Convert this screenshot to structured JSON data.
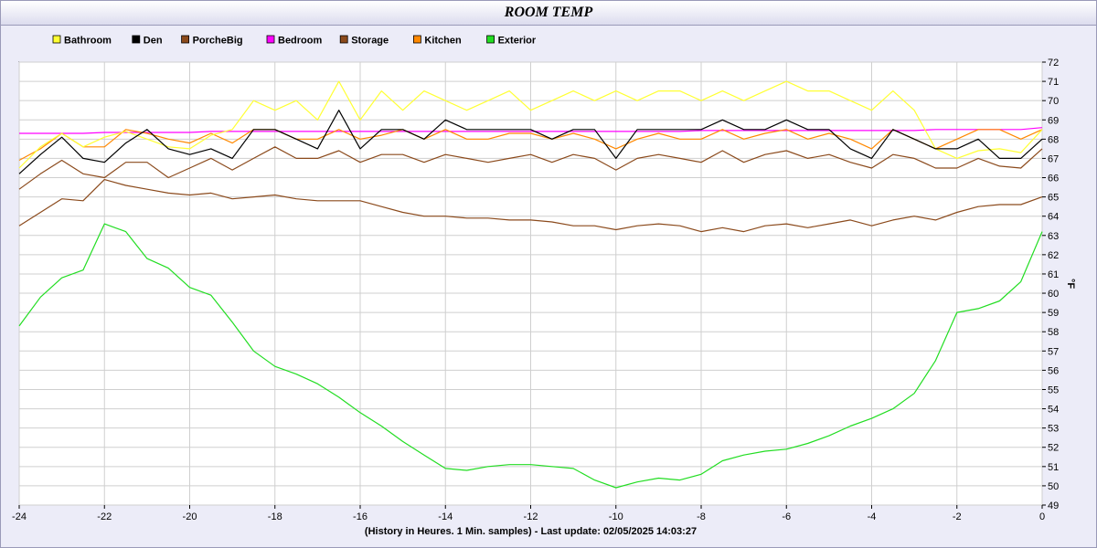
{
  "chart_data": {
    "type": "line",
    "title": "ROOM TEMP",
    "xlabel": "(History in Heures. 1 Min. samples) - Last update: 02/05/2025 14:03:27",
    "ylabel": "°F",
    "xlim": [
      -24,
      0
    ],
    "ylim": [
      49,
      72
    ],
    "x_ticks": [
      -24,
      -22,
      -20,
      -18,
      -16,
      -14,
      -12,
      -10,
      -8,
      -6,
      -4,
      -2,
      0
    ],
    "y_ticks": [
      49,
      50,
      51,
      52,
      53,
      54,
      55,
      56,
      57,
      58,
      59,
      60,
      61,
      62,
      63,
      64,
      65,
      66,
      67,
      68,
      69,
      70,
      71,
      72
    ],
    "grid": true,
    "legend_position": "top-left",
    "x": [
      -24,
      -23.5,
      -23,
      -22.5,
      -22,
      -21.5,
      -21,
      -20.5,
      -20,
      -19.5,
      -19,
      -18.5,
      -18,
      -17.5,
      -17,
      -16.5,
      -16,
      -15.5,
      -15,
      -14.5,
      -14,
      -13.5,
      -13,
      -12.5,
      -12,
      -11.5,
      -11,
      -10.5,
      -10,
      -9.5,
      -9,
      -8.5,
      -8,
      -7.5,
      -7,
      -6.5,
      -6,
      -5.5,
      -5,
      -4.5,
      -4,
      -3.5,
      -3,
      -2.5,
      -2,
      -1.5,
      -1,
      -0.5,
      0
    ],
    "series": [
      {
        "name": "Bathroom",
        "color": "#ffff33",
        "values": [
          66.5,
          67.6,
          68.3,
          67.6,
          68.1,
          68.4,
          68.0,
          67.6,
          67.5,
          68.2,
          68.5,
          70.0,
          69.5,
          70.0,
          69.0,
          71.0,
          69.0,
          70.5,
          69.5,
          70.5,
          70.0,
          69.5,
          70.0,
          70.5,
          69.5,
          70.0,
          70.5,
          70.0,
          70.5,
          70.0,
          70.5,
          70.5,
          70.0,
          70.5,
          70.0,
          70.5,
          71.0,
          70.5,
          70.5,
          70.0,
          69.5,
          70.5,
          69.5,
          67.5,
          67.0,
          67.4,
          67.5,
          67.3,
          68.5
        ]
      },
      {
        "name": "Den",
        "color": "#000000",
        "values": [
          66.2,
          67.2,
          68.1,
          67.0,
          66.8,
          67.8,
          68.5,
          67.5,
          67.2,
          67.5,
          67.0,
          68.5,
          68.5,
          68.0,
          67.5,
          69.5,
          67.5,
          68.5,
          68.5,
          68.0,
          69.0,
          68.5,
          68.5,
          68.5,
          68.5,
          68.0,
          68.5,
          68.5,
          67.0,
          68.5,
          68.5,
          68.5,
          68.5,
          69.0,
          68.5,
          68.5,
          69.0,
          68.5,
          68.5,
          67.5,
          67.0,
          68.5,
          68.0,
          67.5,
          67.5,
          68.0,
          67.0,
          67.0,
          68.0
        ]
      },
      {
        "name": "PorcheBig",
        "color": "#8b4a1c",
        "values": [
          63.5,
          64.2,
          64.9,
          64.8,
          65.9,
          65.6,
          65.4,
          65.2,
          65.1,
          65.2,
          64.9,
          65.0,
          65.1,
          64.9,
          64.8,
          64.8,
          64.8,
          64.5,
          64.2,
          64.0,
          64.0,
          63.9,
          63.9,
          63.8,
          63.8,
          63.7,
          63.5,
          63.5,
          63.3,
          63.5,
          63.6,
          63.5,
          63.2,
          63.4,
          63.2,
          63.5,
          63.6,
          63.4,
          63.6,
          63.8,
          63.5,
          63.8,
          64.0,
          63.8,
          64.2,
          64.5,
          64.6,
          64.6,
          65.0
        ]
      },
      {
        "name": "Bedroom",
        "color": "#ff00ff",
        "values": [
          68.3,
          68.3,
          68.3,
          68.3,
          68.35,
          68.35,
          68.35,
          68.35,
          68.35,
          68.4,
          68.4,
          68.4,
          68.4,
          68.4,
          68.4,
          68.4,
          68.4,
          68.4,
          68.4,
          68.4,
          68.4,
          68.4,
          68.4,
          68.4,
          68.4,
          68.4,
          68.4,
          68.4,
          68.4,
          68.4,
          68.4,
          68.4,
          68.45,
          68.45,
          68.45,
          68.45,
          68.45,
          68.45,
          68.45,
          68.45,
          68.45,
          68.45,
          68.45,
          68.5,
          68.5,
          68.5,
          68.5,
          68.5,
          68.6
        ]
      },
      {
        "name": "Storage",
        "color": "#8b4a1c",
        "values": [
          65.4,
          66.2,
          66.9,
          66.2,
          66.0,
          66.8,
          66.8,
          66.0,
          66.5,
          67.0,
          66.4,
          67.0,
          67.6,
          67.0,
          67.0,
          67.4,
          66.8,
          67.2,
          67.2,
          66.8,
          67.2,
          67.0,
          66.8,
          67.0,
          67.2,
          66.8,
          67.2,
          67.0,
          66.4,
          67.0,
          67.2,
          67.0,
          66.8,
          67.4,
          66.8,
          67.2,
          67.4,
          67.0,
          67.2,
          66.8,
          66.5,
          67.2,
          67.0,
          66.5,
          66.5,
          67.0,
          66.6,
          66.5,
          67.5
        ]
      },
      {
        "name": "Kitchen",
        "color": "#ff8800",
        "values": [
          66.9,
          67.5,
          68.3,
          67.6,
          67.6,
          68.5,
          68.3,
          68.0,
          67.8,
          68.3,
          67.8,
          68.5,
          68.5,
          68.0,
          68.0,
          68.5,
          68.0,
          68.2,
          68.5,
          68.0,
          68.5,
          68.0,
          68.0,
          68.3,
          68.3,
          68.0,
          68.3,
          68.0,
          67.5,
          68.0,
          68.3,
          68.0,
          68.0,
          68.5,
          68.0,
          68.3,
          68.5,
          68.0,
          68.3,
          68.0,
          67.5,
          68.5,
          68.0,
          67.5,
          68.0,
          68.5,
          68.5,
          68.0,
          68.5
        ]
      },
      {
        "name": "Exterior",
        "color": "#22dd22",
        "values": [
          58.3,
          59.8,
          60.8,
          61.2,
          63.6,
          63.2,
          61.8,
          61.3,
          60.3,
          59.9,
          58.5,
          57.0,
          56.2,
          55.8,
          55.3,
          54.6,
          53.8,
          53.1,
          52.3,
          51.6,
          50.9,
          50.8,
          51.0,
          51.1,
          51.1,
          51.0,
          50.9,
          50.3,
          49.9,
          50.2,
          50.4,
          50.3,
          50.6,
          51.3,
          51.6,
          51.8,
          51.9,
          52.2,
          52.6,
          53.1,
          53.5,
          54.0,
          54.8,
          56.5,
          59.0,
          59.2,
          59.6,
          60.6,
          63.2
        ]
      }
    ]
  }
}
